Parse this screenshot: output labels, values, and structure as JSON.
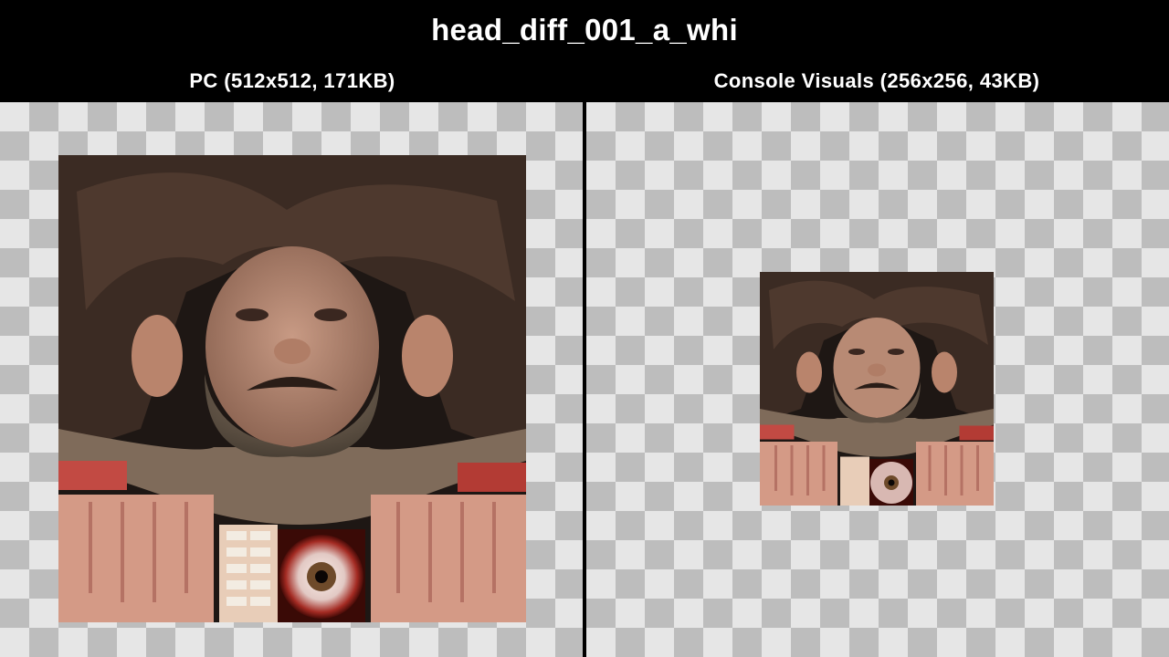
{
  "texture_name": "head_diff_001_a_whi",
  "panes": [
    {
      "label": "PC (512x512, 171KB)",
      "image": "head-texture-atlas-pc"
    },
    {
      "label": "Console Visuals (256x256, 43KB)",
      "image": "head-texture-atlas-console"
    }
  ],
  "colors": {
    "background": "#000000",
    "checker_light": "#e6e6e6",
    "checker_dark": "#bdbdbd",
    "text": "#ffffff"
  }
}
